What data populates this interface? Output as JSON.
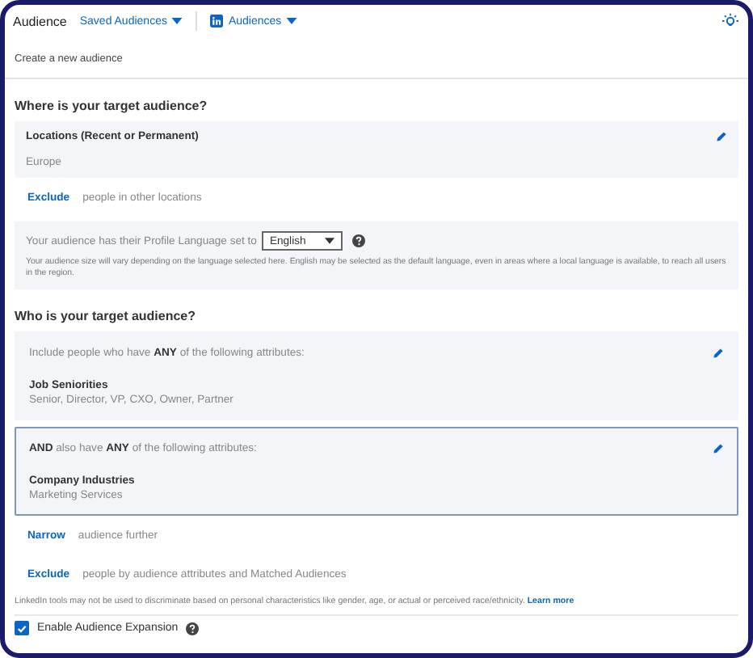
{
  "header": {
    "title": "Audience",
    "menus": [
      {
        "label": "Saved Audiences",
        "kind": "plain"
      },
      {
        "label": "Audiences",
        "kind": "brand"
      }
    ]
  },
  "subtitle": "Create a new audience",
  "where": {
    "heading": "Where is your target audience?",
    "location_card": {
      "label": "Locations (Recent or Permanent)",
      "value": "Europe"
    },
    "exclude": {
      "link": "Exclude",
      "text": "people in other locations"
    },
    "language": {
      "prefix": "Your audience has their Profile Language set to",
      "value": "English",
      "note": "Your audience size will vary depending on the language selected here. English may be selected as the default language, even in areas where a local language is available, to reach all users in the region."
    }
  },
  "who": {
    "heading": "Who is your target audience?",
    "groups": [
      {
        "intro": "Include people who have **ANY** of the following attributes:",
        "attribute": "Job Seniorities",
        "values": "Senior, Director, VP, CXO, Owner, Partner",
        "selected": false
      },
      {
        "intro": "**AND** also have **ANY** of the following attributes:",
        "attribute": "Company Industries",
        "values": "Marketing Services",
        "selected": true
      }
    ],
    "actions": [
      {
        "link": "Narrow",
        "text": "audience further"
      },
      {
        "link": "Exclude",
        "text": "people by audience attributes and Matched Audiences"
      }
    ]
  },
  "disclaimer": {
    "text": "LinkedIn tools may not be used to discriminate based on personal characteristics like gender, age, or actual or perceived race/ethnicity.",
    "link": "Learn more"
  },
  "expansion": {
    "label": "Enable Audience Expansion",
    "checked": true
  }
}
